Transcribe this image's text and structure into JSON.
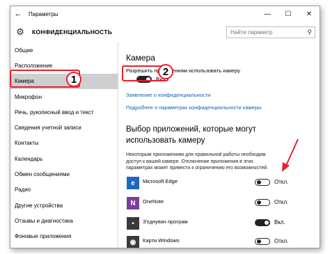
{
  "window": {
    "title": "Параметры"
  },
  "window_controls": {
    "minimize": "—",
    "maximize": "☐",
    "close": "✕"
  },
  "header": {
    "section_title": "КОНФИДЕНЦИАЛЬНОСТЬ",
    "search_placeholder": "Найти параметр"
  },
  "sidebar": {
    "items": [
      {
        "label": "Общие"
      },
      {
        "label": "Расположение"
      },
      {
        "label": "Камера",
        "active": true
      },
      {
        "label": "Микрофон"
      },
      {
        "label": "Речь, рукописный ввод и текст"
      },
      {
        "label": "Сведения учетной записи"
      },
      {
        "label": "Контакты"
      },
      {
        "label": "Календарь"
      },
      {
        "label": "Обмен сообщениями"
      },
      {
        "label": "Радио"
      },
      {
        "label": "Другие устройства"
      },
      {
        "label": "Отзывы и диагностика"
      },
      {
        "label": "Фоновые приложения"
      }
    ]
  },
  "main": {
    "heading": "Камера",
    "allow_label": "Разрешить приложениям использовать камеру",
    "main_toggle": {
      "state": "Вкл.",
      "on": true
    },
    "privacy_link": "Заявление о конфиденциальности",
    "more_link": "Подробнее о параметрах конфиденциальности камеры",
    "choose_heading": "Выбор приложений, которые могут использовать камеру",
    "description": "Некоторым приложениям для правильной работы необходим доступ к вашей камере. Отключение приложения в этих параметрах может привести к ограничению его возможностей.",
    "apps": [
      {
        "name": "Microsoft Edge",
        "state": "Откл.",
        "on": false,
        "icon": "edge-icon",
        "color": "#1e66c2"
      },
      {
        "name": "OneNote",
        "state": "Откл.",
        "on": false,
        "icon": "onenote-icon",
        "color": "#7a3e9d"
      },
      {
        "name": "З'єднувач програм",
        "state": "Вкл.",
        "on": true,
        "icon": "connector-icon",
        "color": "#3a3a3a"
      },
      {
        "name": "Карти Windows",
        "state": "Откл.",
        "on": false,
        "icon": "maps-icon",
        "color": "#3a3a3a"
      }
    ]
  },
  "annotations": {
    "marker_1": "1",
    "marker_2": "2"
  },
  "colors": {
    "annotation": "#e8202a",
    "link": "#1160b0",
    "active_item": "#cfcfcf"
  }
}
